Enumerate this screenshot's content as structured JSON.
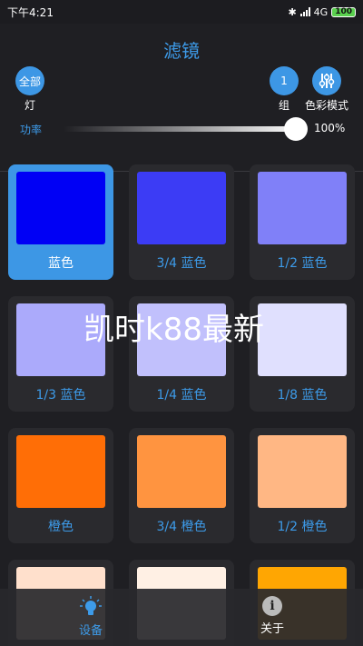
{
  "status_bar": {
    "time": "下午4:21",
    "network": "4G",
    "battery": "100"
  },
  "header": {
    "title": "滤镜",
    "all_button": {
      "circle_text": "全部",
      "label": "灯"
    },
    "group_button": {
      "circle_text": "1",
      "label": "组"
    },
    "color_mode_button": {
      "label": "色彩模式"
    },
    "power": {
      "label": "功率",
      "value_text": "100%",
      "level": 1.0
    }
  },
  "filters": [
    {
      "label": "蓝色",
      "color": "#0000f5",
      "selected": true
    },
    {
      "label": "3/4 蓝色",
      "color": "#3c3cf5",
      "selected": false
    },
    {
      "label": "1/2 蓝色",
      "color": "#8080f8",
      "selected": false
    },
    {
      "label": "1/3 蓝色",
      "color": "#abaafb",
      "selected": false
    },
    {
      "label": "1/4 蓝色",
      "color": "#c1c0fc",
      "selected": false
    },
    {
      "label": "1/8 蓝色",
      "color": "#e0e0fe",
      "selected": false
    },
    {
      "label": "橙色",
      "color": "#ff6e06",
      "selected": false
    },
    {
      "label": "3/4 橙色",
      "color": "#ff9440",
      "selected": false
    },
    {
      "label": "1/2 橙色",
      "color": "#ffb784",
      "selected": false
    },
    {
      "label": "",
      "color": "#ffe0cc",
      "selected": false
    },
    {
      "label": "",
      "color": "#fff0e4",
      "selected": false
    },
    {
      "label": "",
      "color": "#ffa602",
      "selected": false
    }
  ],
  "watermark": "凯时k88最新",
  "bottom_nav": {
    "devices_label": "设备",
    "about_label": "关于",
    "about_icon_text": "i",
    "accent": "#3d9be9"
  }
}
